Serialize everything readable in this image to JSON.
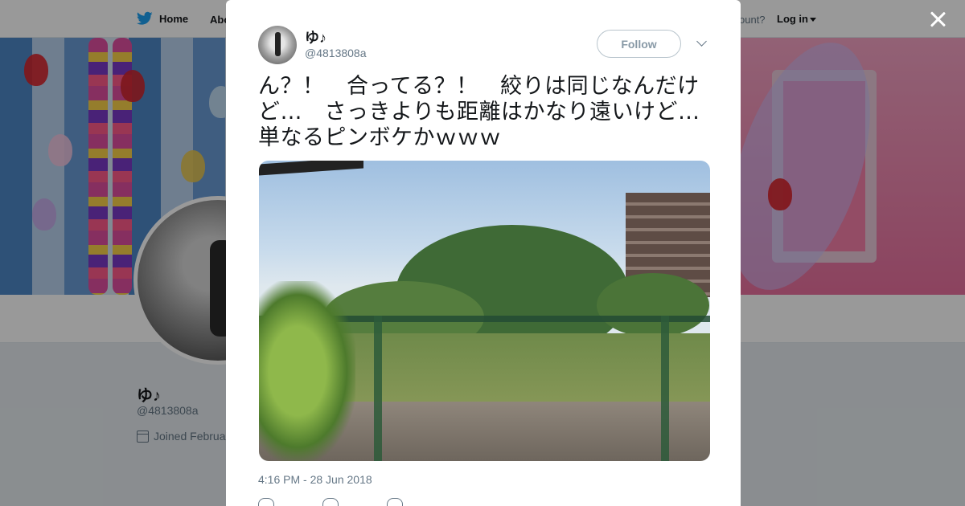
{
  "background_page": {
    "nav": {
      "home": "Home",
      "about": "Abo"
    },
    "account_prompt": "ccount?",
    "login": "Log in",
    "profile": {
      "name": "ゆ♪",
      "handle": "@4813808a",
      "joined": "Joined Februa"
    }
  },
  "tweet": {
    "author_name": "ゆ♪",
    "author_handle": "@4813808a",
    "follow_label": "Follow",
    "text": "ん？！　合ってる？！　絞りは同じなんだけど…　さっきよりも距離はかなり遠いけど…　単なるピンボケかｗｗｗ",
    "timestamp": "4:16 PM - 28 Jun 2018"
  },
  "icons": {
    "logo": "twitter-bird-icon",
    "close": "close-icon",
    "menu": "chevron-down-icon",
    "reply": "reply-icon",
    "retweet": "retweet-icon",
    "like": "heart-icon",
    "joined": "calendar-icon"
  },
  "colors": {
    "brand": "#1da1f2",
    "text": "#14171a",
    "muted": "#657786",
    "overlay": "rgba(0,0,0,0.40)"
  }
}
